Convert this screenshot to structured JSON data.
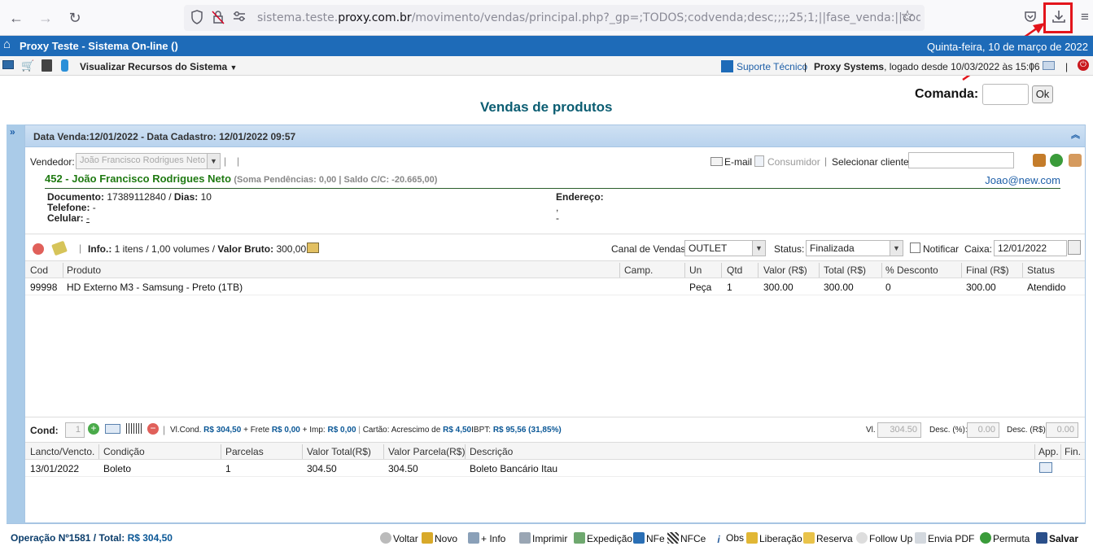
{
  "browser": {
    "url_prefix": "sistema.teste.",
    "url_domain": "proxy.com.br",
    "url_path": "/movimento/vendas/principal.php?_gp=;TODOS;codvenda;desc;;;;25;1;||fase_venda:||codvendedor:||cana"
  },
  "header": {
    "title": "Proxy Teste - Sistema On-line ()",
    "date": "Quinta-feira, 10 de março de 2022"
  },
  "toolbar": {
    "resources": "Visualizar Recursos do Sistema",
    "support": "Suporte Técnico",
    "company": "Proxy Systems",
    "logged": ", logado desde 10/03/2022 às 15:06"
  },
  "page": {
    "title": "Vendas de produtos",
    "comanda_label": "Comanda:",
    "comanda_value": "",
    "ok_label": "Ok"
  },
  "panel": {
    "heading": "Data Venda:12/01/2022 - Data Cadastro: 12/01/2022 09:57"
  },
  "seller": {
    "label": "Vendedor:",
    "value": "João Francisco Rodrigues Neto",
    "email_label": "E-mail",
    "consumer_label": "Consumidor",
    "select_client_label": "Selecionar cliente:",
    "select_client_value": ""
  },
  "client": {
    "name": "452 - João Francisco Rodrigues Neto",
    "summary": "(Soma Pendências: 0,00 | Saldo C/C: -20.665,00)",
    "email": "Joao@new.com",
    "doc_label": "Documento:",
    "doc_value": "17389112840",
    "days_label": "Dias:",
    "days_value": "10",
    "phone_label": "Telefone:",
    "phone_value": "-",
    "cell_label": "Celular:",
    "cell_value": "-",
    "address_label": "Endereço:",
    "address_line1": ",",
    "address_line2": "-"
  },
  "info": {
    "label": "Info.:",
    "items": "1 itens / 1,00 volumes /",
    "gross_label": "Valor Bruto:",
    "gross_value": "300,00",
    "channel_label": "Canal de Vendas:",
    "channel_value": "OUTLET",
    "status_label": "Status:",
    "status_value": "Finalizada",
    "notify_label": "Notificar",
    "caixa_label": "Caixa:",
    "caixa_value": "12/01/2022"
  },
  "products": {
    "columns": [
      "Cod",
      "Produto",
      "Camp.",
      "Un",
      "Qtd",
      "Valor (R$)",
      "Total (R$)",
      "% Desconto",
      "Final (R$)",
      "Status"
    ],
    "rows": [
      [
        "99998",
        "HD Externo M3 - Samsung - Preto (1TB)",
        "",
        "Peça",
        "1",
        "300.00",
        "300.00",
        "0",
        "300.00",
        "Atendido"
      ]
    ]
  },
  "cond": {
    "label": "Cond:",
    "value": "1",
    "vl_cond_label": "Vl.Cond.",
    "vl_cond_value": "R$ 304,50",
    "frete_label": "+ Frete",
    "frete_value": "R$ 0,00",
    "imp_label": "+ Imp:",
    "imp_value": "R$ 0,00",
    "cartao_label": "Cartão: Acrescimo de",
    "cartao_value": "R$ 4,50",
    "ibpt_label": "IBPT:",
    "ibpt_value": "R$ 95,56 (31,85%)",
    "vl_pagar_label": "Vl. Pagar:",
    "vl_pagar_value": "304.50",
    "desc_pct_label": "Desc. (%):",
    "desc_pct_value": "0.00",
    "desc_rs_label": "Desc. (R$):",
    "desc_rs_value": "0.00"
  },
  "payments": {
    "columns": [
      "Lancto/Vencto.",
      "Condição",
      "Parcelas",
      "Valor Total(R$)",
      "Valor Parcela(R$)",
      "Descrição",
      "App.",
      "Fin."
    ],
    "rows": [
      [
        "13/01/2022",
        "Boleto",
        "1",
        "304.50",
        "304.50",
        "Boleto Bancário Itau"
      ]
    ]
  },
  "footer": {
    "operation": "Operação Nº1581 /",
    "total_label": "Total:",
    "total_value": "R$ 304,50",
    "actions": [
      "Voltar",
      "Novo",
      "+ Info",
      "Imprimir",
      "Expedição",
      "NFe",
      "NFCe",
      "Obs",
      "Liberação",
      "Reserva",
      "Follow Up",
      "Envia PDF",
      "Permuta",
      "Salvar"
    ]
  },
  "colors": {
    "header_blue": "#1e6bb8",
    "client_green": "#1f7a12",
    "title_teal": "#0b5d72",
    "highlight_red": "#e3141b"
  }
}
